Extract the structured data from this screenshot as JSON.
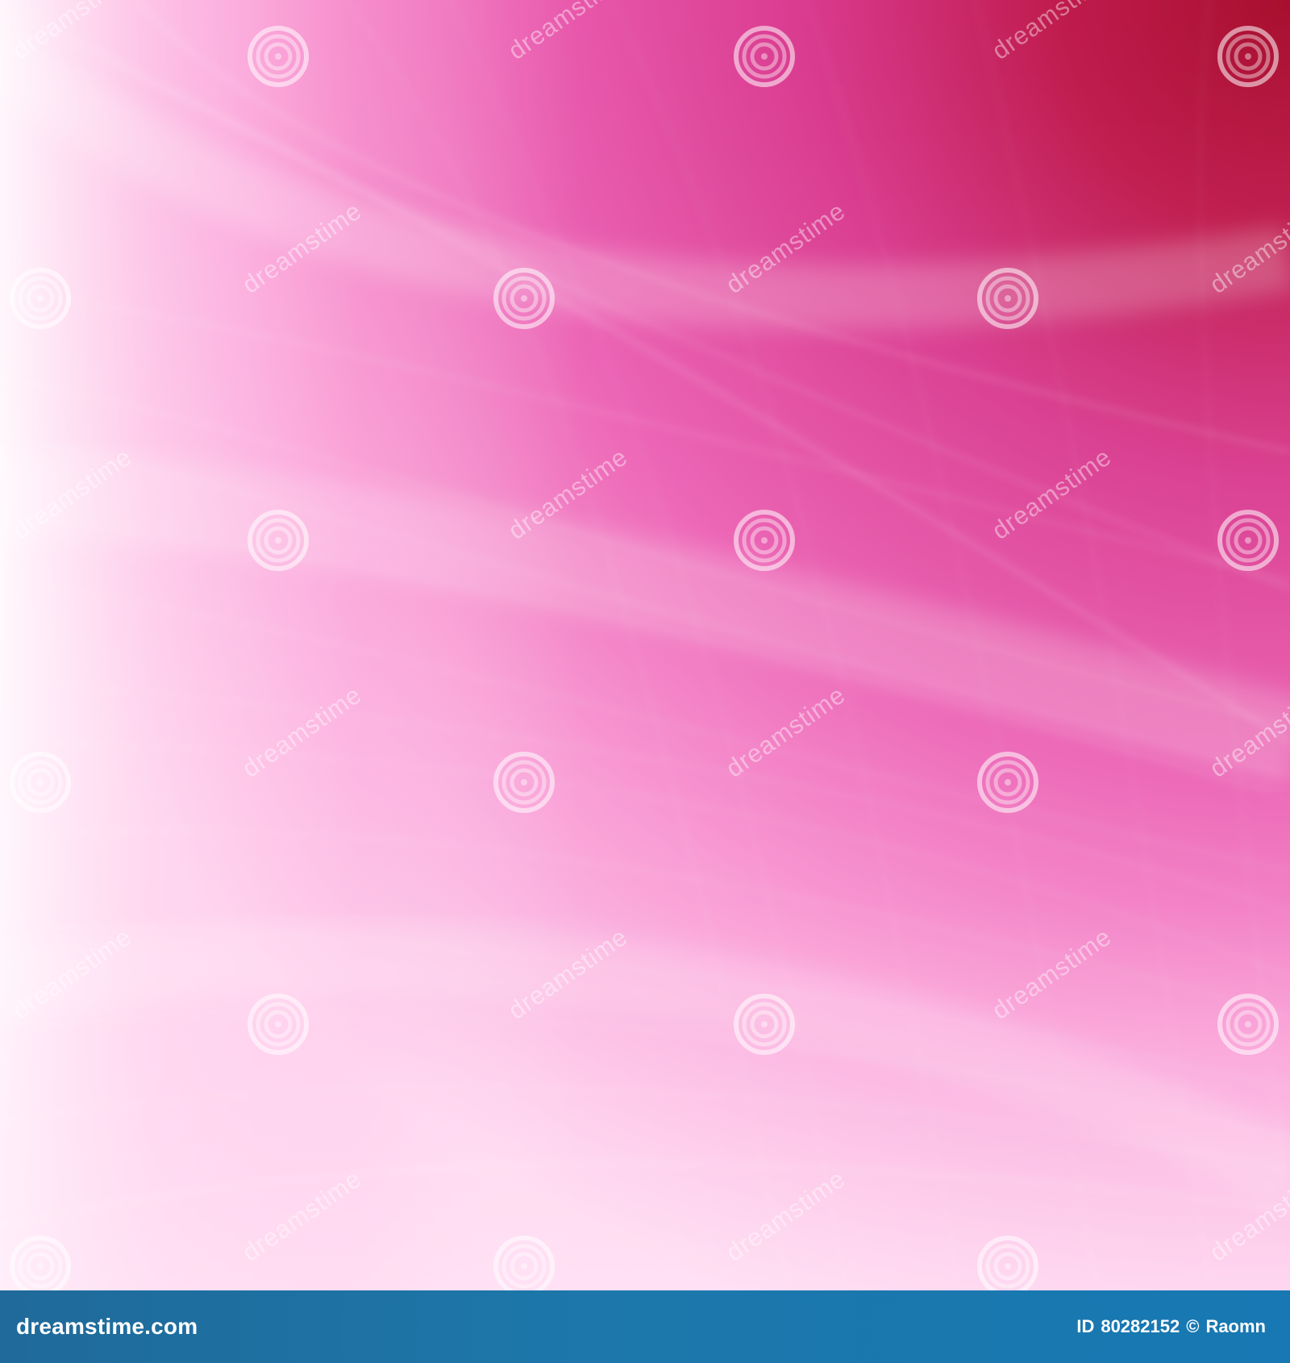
{
  "image": {
    "description": "Abstract pink wave background with curved light streaks",
    "palette": {
      "top_right": "#b5173d",
      "middle": "#e3479b",
      "bottom_left": "#ffd4ef",
      "accent": "#ffffff"
    }
  },
  "watermarks": {
    "text": "dreamstime",
    "icon": "spiral-watermark-icon"
  },
  "footer": {
    "brand": "dreamstime.com",
    "id_label": "ID",
    "id_value": "80282152",
    "copyright_symbol": "©",
    "author": "Raomn"
  }
}
